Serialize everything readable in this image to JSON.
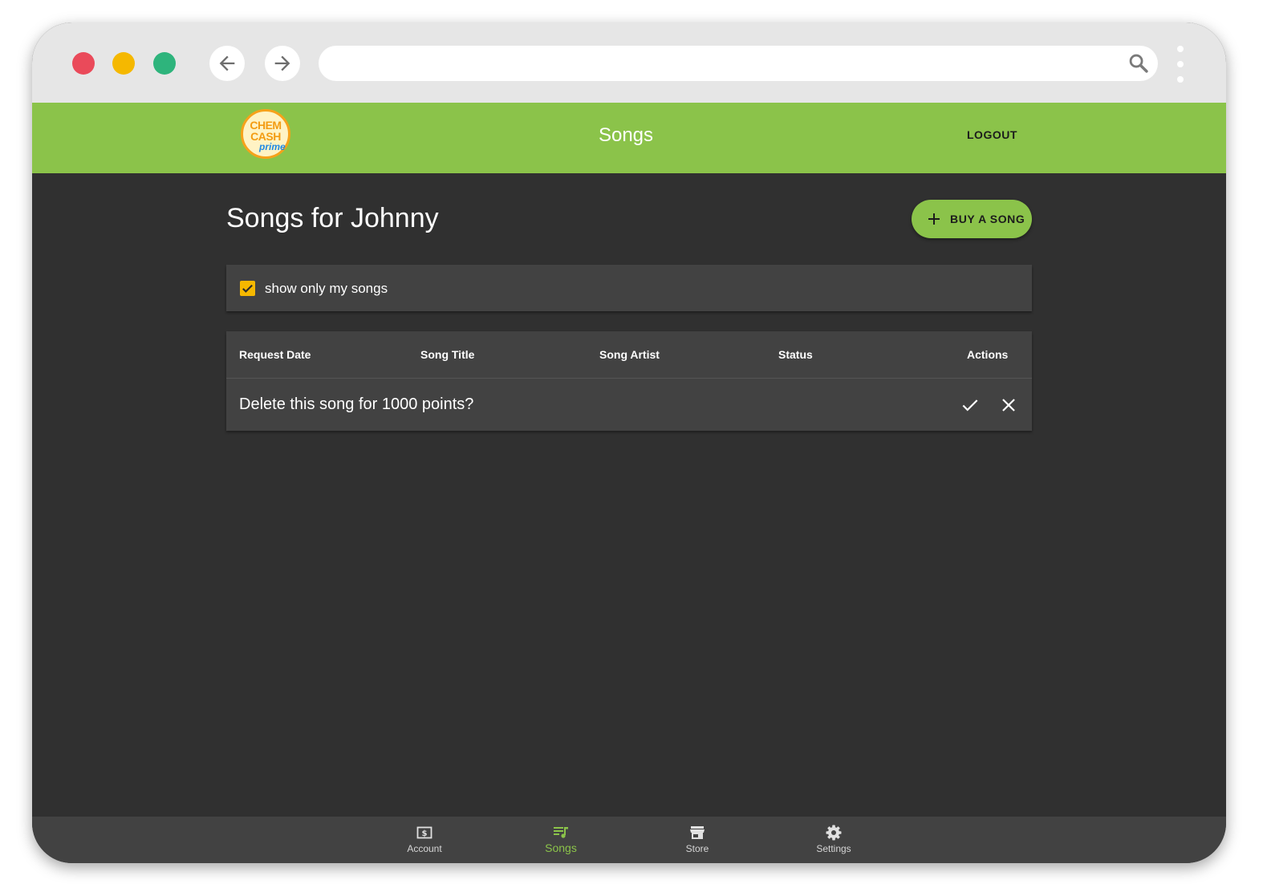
{
  "app": {
    "title": "Songs",
    "logout_label": "LOGOUT",
    "logo": {
      "line1": "CHEM",
      "line2": "CASH",
      "line3": "prime"
    }
  },
  "page": {
    "heading": "Songs for Johnny",
    "buy_button_label": "BUY A SONG"
  },
  "filter": {
    "label": "show only my songs",
    "checked": true
  },
  "table": {
    "headers": [
      "Request Date",
      "Song Title",
      "Song Artist",
      "Status",
      "Actions"
    ],
    "delete_prompt": "Delete this song for 1000 points?"
  },
  "bottom_nav": {
    "items": [
      {
        "label": "Account",
        "icon": "account-dollar-icon",
        "active": false
      },
      {
        "label": "Songs",
        "icon": "queue-music-icon",
        "active": true
      },
      {
        "label": "Store",
        "icon": "store-icon",
        "active": false
      },
      {
        "label": "Settings",
        "icon": "gear-icon",
        "active": false
      }
    ]
  },
  "colors": {
    "accent": "#8bc34a",
    "checkbox": "#f5b800",
    "background": "#303030",
    "surface": "#424242"
  }
}
